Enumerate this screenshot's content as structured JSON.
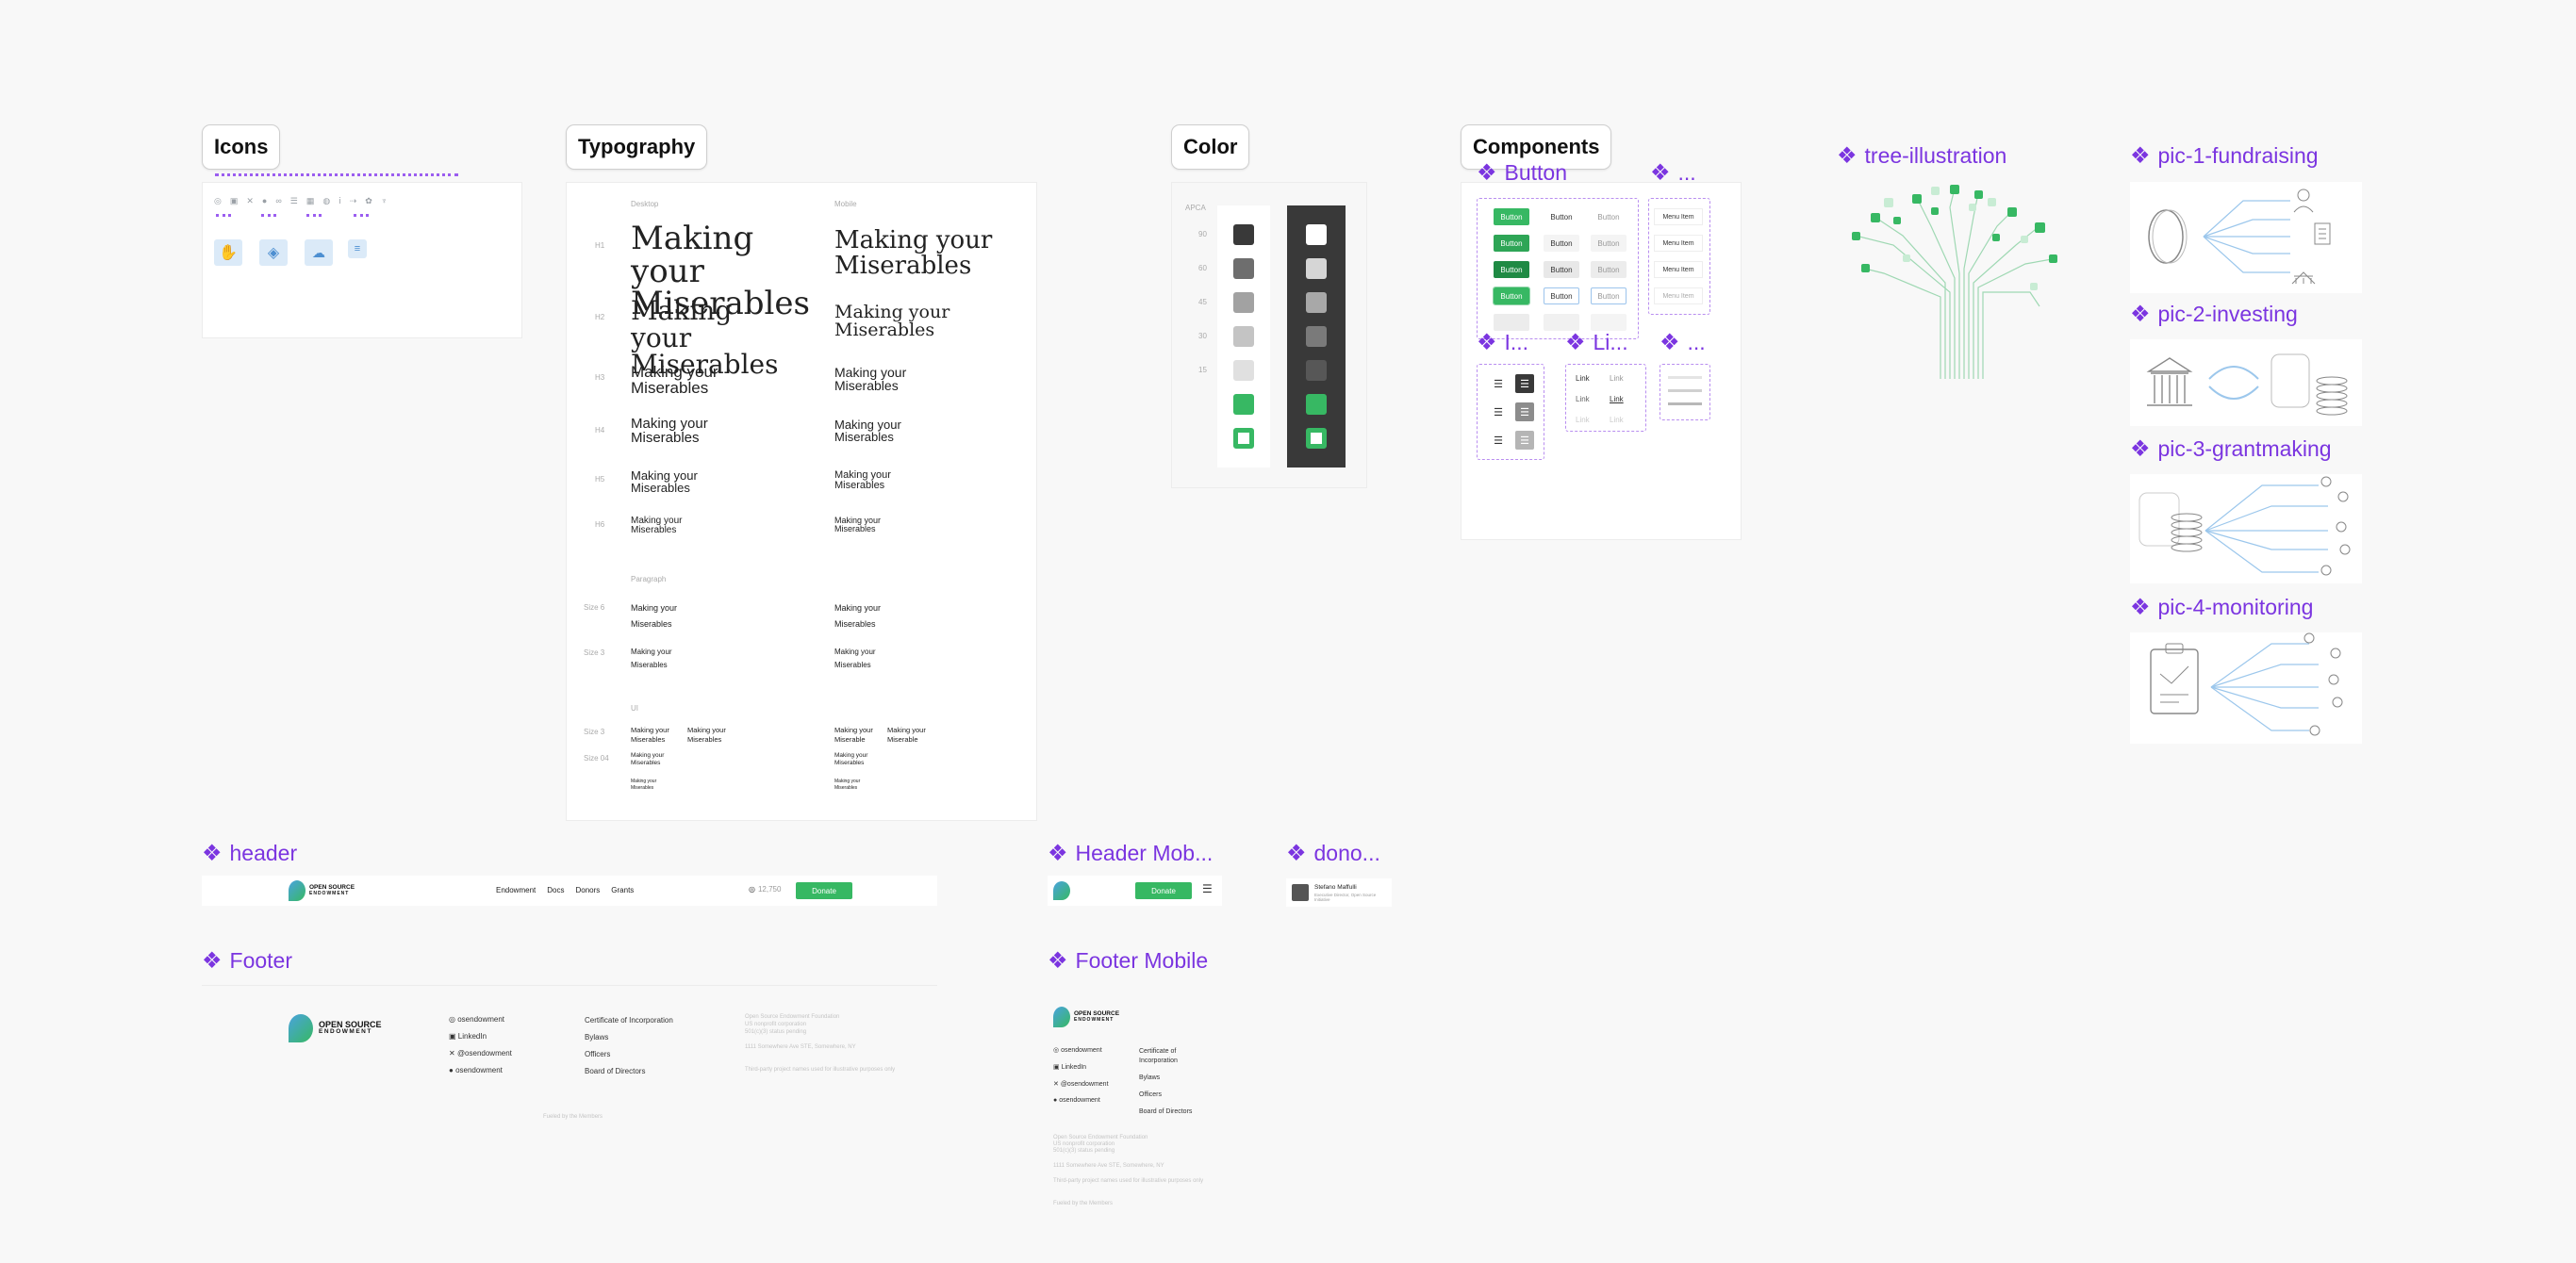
{
  "sections": {
    "icons": "Icons",
    "typography": "Typography",
    "color": "Color",
    "components": "Components"
  },
  "components": {
    "button": "Button",
    "menu_trunc": "...",
    "i_trunc": "I...",
    "link_trunc": "Li...",
    "dots_trunc": "...",
    "tree": "tree-illustration",
    "pic1": "pic-1-fundraising",
    "pic2": "pic-2-investing",
    "pic3": "pic-3-grantmaking",
    "pic4": "pic-4-monitoring",
    "header": "header",
    "header_mobile": "Header Mob...",
    "donor": "dono...",
    "footer": "Footer",
    "footer_mobile": "Footer Mobile"
  },
  "button_labels": [
    "Button",
    "Button",
    "Button"
  ],
  "menu_item_label": "Menu Item",
  "link_label": "Link",
  "typography": {
    "col_desktop": "Desktop",
    "col_mobile": "Mobile",
    "rows": [
      "H1",
      "H2",
      "H3",
      "H4",
      "H5",
      "H6"
    ],
    "sample": "Making your Miserables",
    "paragraph_label": "Paragraph",
    "para_rows": [
      "Size 6",
      "Size 3"
    ],
    "ui_label": "UI",
    "ui_rows": [
      "Size 3",
      "Size 04",
      ""
    ],
    "sample_ui_mobile": "Making your Miserable"
  },
  "color": {
    "label": "APCA",
    "levels": [
      "90",
      "60",
      "45",
      "30",
      "15",
      "",
      ""
    ]
  },
  "header": {
    "logo_line1": "OPEN SOURCE",
    "logo_line2": "ENDOWMENT",
    "nav": [
      "Endowment",
      "Docs",
      "Donors",
      "Grants"
    ],
    "stars": "12,750",
    "donate": "Donate"
  },
  "donor_card": {
    "name": "Stefano Maffulli",
    "role": "Executive Director, Open Source Initiative"
  },
  "footer": {
    "social": [
      "osendowment",
      "LinkedIn",
      "@osendowment",
      "osendowment"
    ],
    "links": [
      "Certificate of Incorporation",
      "Bylaws",
      "Officers",
      "Board of Directors"
    ],
    "links_mobile": [
      "Certificate of Incorporation",
      "Bylaws",
      "Officers",
      "Board of Directors"
    ],
    "legal1": "Open Source Endowment Foundation",
    "legal2": "US nonprofit corporation",
    "legal3": "501(c)(3) status pending",
    "addr": "1111 Somewhere Ave STE, Somewhere, NY",
    "note": "Third-party project names used for illustrative purposes only",
    "bottom": "Fueled by the Members"
  },
  "colors": {
    "accent_purple": "#7b35e0",
    "brand_green": "#37b863",
    "dark": "#393939"
  }
}
